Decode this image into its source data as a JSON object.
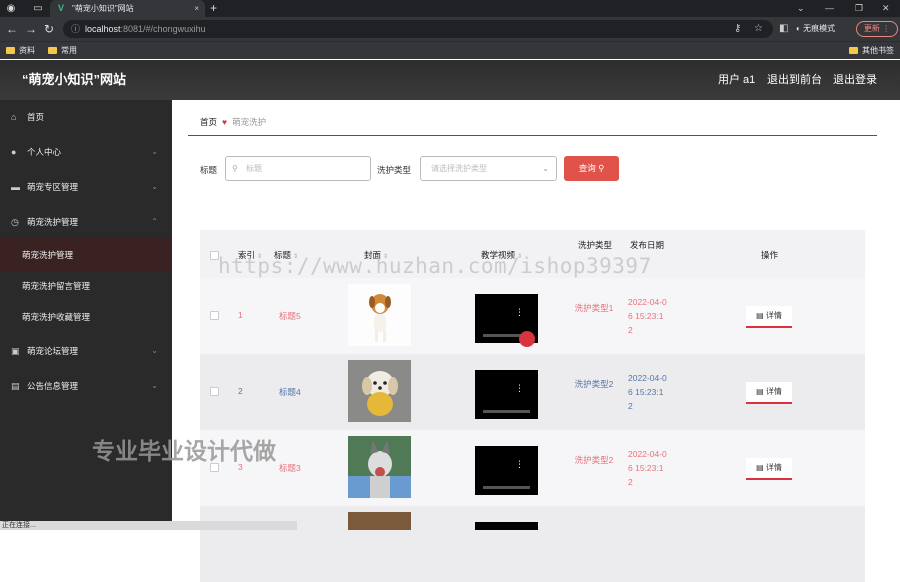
{
  "browser": {
    "tab_title": "\"萌宠小知识\"网站",
    "tab_logo": "V",
    "tab_close": "×",
    "new_tab": "+",
    "url_host": "localhost",
    "url_path": ":8081/#/chongwuxihu",
    "incognito_label": "无痕模式",
    "update_label": "更新",
    "bookmarks": [
      "资料",
      "常用"
    ],
    "other_bookmarks": "其他书签",
    "status_text": "正在连接..."
  },
  "header": {
    "site_title": "“萌宠小知识”网站",
    "user": "用户 a1",
    "back_link": "退出到前台",
    "logout": "退出登录"
  },
  "sidebar": {
    "items": [
      {
        "label": "首页",
        "icon": "home-icon"
      },
      {
        "label": "个人中心",
        "icon": "user-icon"
      },
      {
        "label": "萌宠专区管理",
        "icon": "monitor-icon"
      },
      {
        "label": "萌宠洗护管理",
        "icon": "clock-icon"
      },
      {
        "label": "萌宠洗护管理"
      },
      {
        "label": "萌宠洗护留言管理"
      },
      {
        "label": "萌宠洗护收藏管理"
      },
      {
        "label": "萌宠论坛管理",
        "icon": "forum-icon"
      },
      {
        "label": "公告信息管理",
        "icon": "notice-icon"
      }
    ]
  },
  "breadcrumb": {
    "home": "首页",
    "current": "萌宠洗护"
  },
  "search": {
    "title_label": "标题",
    "title_placeholder": "标题",
    "type_label": "洗护类型",
    "type_placeholder": "请选择洗护类型",
    "query_button": "查询"
  },
  "table": {
    "headers": [
      "索引",
      "标题",
      "封面",
      "教学视频",
      "洗护类型",
      "发布日期",
      "操作"
    ],
    "rows": [
      {
        "index": "1",
        "title": "标题5",
        "type": "洗护类型1",
        "date": "2022-04-06 15:23:12",
        "action": "详情"
      },
      {
        "index": "2",
        "title": "标题4",
        "type": "洗护类型2",
        "date": "2022-04-06 15:23:12",
        "action": "详情"
      },
      {
        "index": "3",
        "title": "标题3",
        "type": "洗护类型2",
        "date": "2022-04-06 15:23:12",
        "action": "详情"
      }
    ]
  },
  "watermarks": {
    "url": "https://www.huzhan.com/ishop39397",
    "promo": "专业毕业设计代做"
  },
  "colors": {
    "accent": "#e0534b",
    "sidebar_bg": "#2a2a2a",
    "header_bg": "#333333"
  }
}
